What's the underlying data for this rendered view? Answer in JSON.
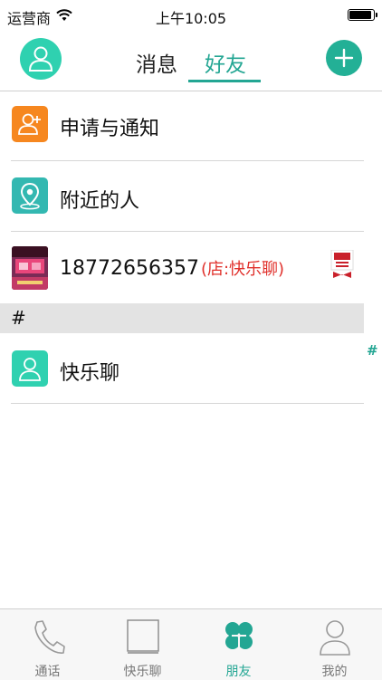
{
  "status_bar": {
    "carrier": "运营商",
    "time": "上午10:05"
  },
  "nav": {
    "tabs": [
      "消息",
      "好友"
    ],
    "active_tab": "好友"
  },
  "friends_list": {
    "items": [
      {
        "label": "申请与通知",
        "icon": "add-user-icon"
      },
      {
        "label": "附近的人",
        "icon": "location-pin-icon"
      },
      {
        "label": "18772656357",
        "shop_tag": "(店:快乐聊)",
        "icon": "shop-avatar",
        "badge": "店长 Stamp"
      }
    ],
    "section_header": "#",
    "section_items": [
      {
        "label": "快乐聊",
        "icon": "user-avatar-icon"
      }
    ],
    "index_bar": [
      "#"
    ]
  },
  "tab_bar": {
    "items": [
      {
        "label": "通话",
        "icon": "phone-icon"
      },
      {
        "label": "快乐聊",
        "icon": "chat-square-icon"
      },
      {
        "label": "朋友",
        "icon": "clover-icon"
      },
      {
        "label": "我的",
        "icon": "person-icon"
      }
    ],
    "active": "朋友"
  },
  "colors": {
    "accent": "#23a693",
    "accent_light": "#2fd1b0",
    "notify_orange": "#f6871f",
    "location_teal": "#33b8b1",
    "shop_tag_red": "#e0302b"
  }
}
